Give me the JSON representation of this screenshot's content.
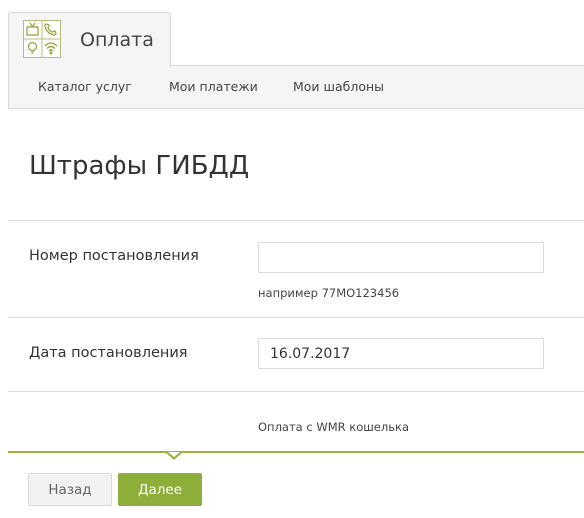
{
  "header": {
    "tab_title": "Оплата",
    "icons": [
      "tv-icon",
      "phone-icon",
      "lightbulb-icon",
      "wifi-icon"
    ],
    "accent_color": "#9eb13e"
  },
  "subnav": {
    "items": [
      {
        "label": "Каталог услуг"
      },
      {
        "label": "Мои платежи"
      },
      {
        "label": "Мои шаблоны"
      }
    ]
  },
  "page": {
    "title": "Штрафы ГИБДД"
  },
  "form": {
    "resolution_number": {
      "label": "Номер постановления",
      "value": "",
      "hint": "например 77МО123456"
    },
    "resolution_date": {
      "label": "Дата постановления",
      "value": "16.07.2017"
    },
    "payment_method": "Оплата с WMR кошелька"
  },
  "actions": {
    "back_label": "Назад",
    "next_label": "Далее",
    "next_color": "#8eae3c"
  }
}
